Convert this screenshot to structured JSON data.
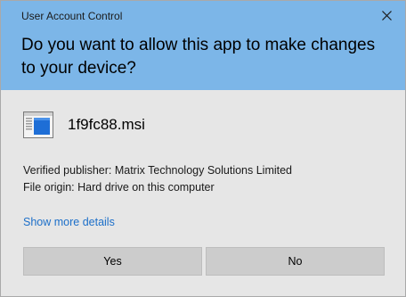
{
  "window": {
    "title": "User Account Control",
    "close_icon": "close-icon"
  },
  "prompt": {
    "question": "Do you want to allow this app to make changes to your device?"
  },
  "app": {
    "icon": "installer-window-icon",
    "name": "1f9fc88.msi"
  },
  "details": {
    "publisher_line": "Verified publisher: Matrix Technology Solutions Limited",
    "origin_line": "File origin: Hard drive on this computer",
    "show_more_label": "Show more details"
  },
  "buttons": {
    "yes_label": "Yes",
    "no_label": "No"
  },
  "colors": {
    "header_bg": "#7cb6e8",
    "body_bg": "#e6e6e6",
    "link": "#1c6fc9",
    "button_bg": "#cccccc"
  }
}
